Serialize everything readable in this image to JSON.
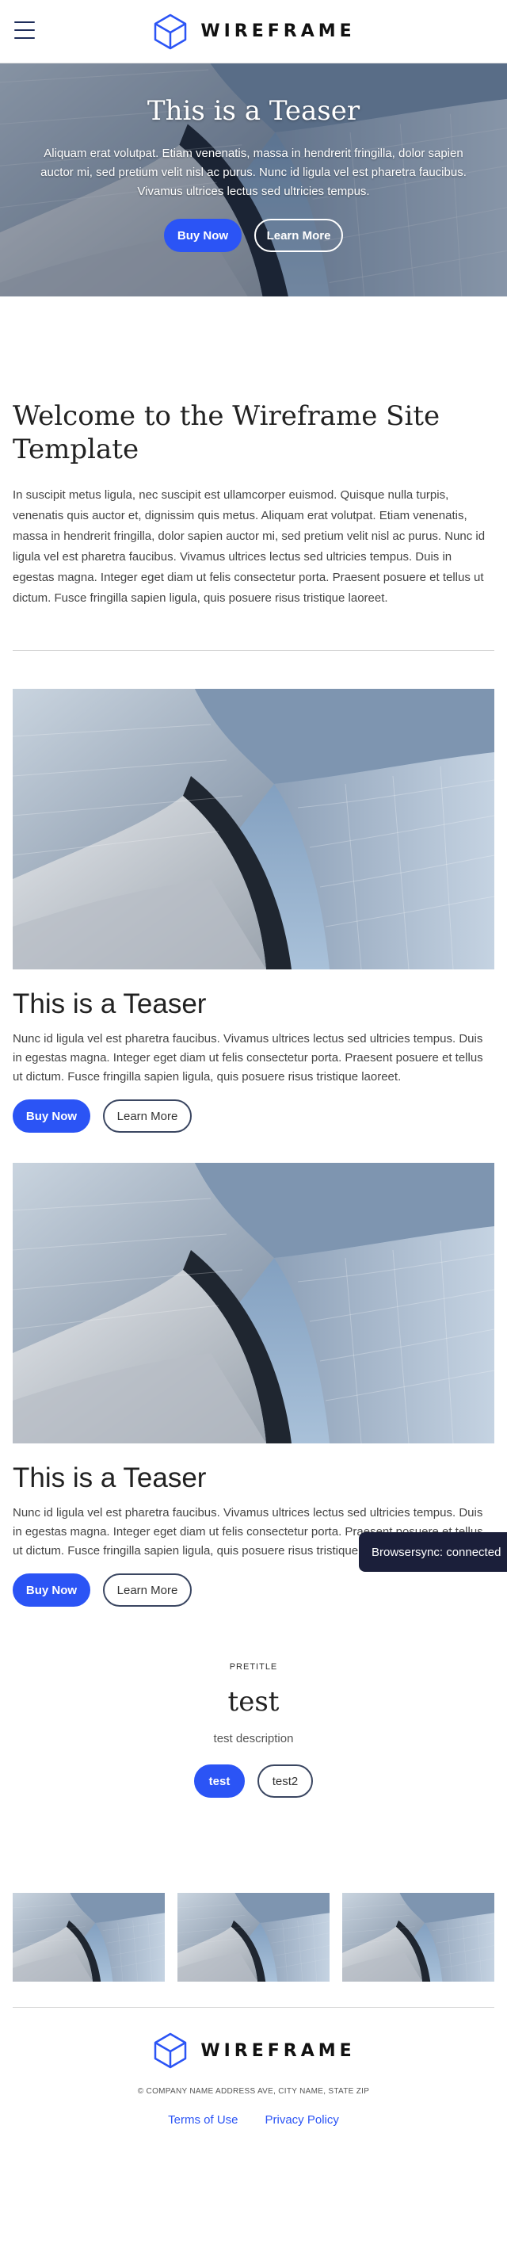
{
  "header": {
    "brand": "WIREFRAME",
    "menu_icon": "hamburger-menu-icon",
    "logo_icon": "cube-logo-icon"
  },
  "hero": {
    "title": "This is a Teaser",
    "text": "Aliquam erat volutpat. Etiam venenatis, massa in hendrerit fringilla, dolor sapien auctor mi, sed pretium velit nisl ac purus. Nunc id ligula vel est pharetra faucibus. Vivamus ultrices lectus sed ultricies tempus.",
    "primary_label": "Buy Now",
    "secondary_label": "Learn More"
  },
  "welcome": {
    "title": "Welcome to the Wireframe Site Template",
    "body": "In suscipit metus ligula, nec suscipit est ullamcorper euismod. Quisque nulla turpis, venenatis quis auctor et, dignissim quis metus. Aliquam erat volutpat. Etiam venenatis, massa in hendrerit fringilla, dolor sapien auctor mi, sed pretium velit nisl ac purus. Nunc id ligula vel est pharetra faucibus. Vivamus ultrices lectus sed ultricies tempus. Duis in egestas magna. Integer eget diam ut felis consectetur porta. Praesent posuere et tellus ut dictum. Fusce fringilla sapien ligula, quis posuere risus tristique laoreet."
  },
  "teasers": [
    {
      "title": "This is a Teaser",
      "text": "Nunc id ligula vel est pharetra faucibus. Vivamus ultrices lectus sed ultricies tempus. Duis in egestas magna. Integer eget diam ut felis consectetur porta. Praesent posuere et tellus ut dictum. Fusce fringilla sapien ligula, quis posuere risus tristique laoreet.",
      "primary_label": "Buy Now",
      "secondary_label": "Learn More"
    },
    {
      "title": "This is a Teaser",
      "text": "Nunc id ligula vel est pharetra faucibus. Vivamus ultrices lectus sed ultricies tempus. Duis in egestas magna. Integer eget diam ut felis consectetur porta. Praesent posuere et tellus ut dictum. Fusce fringilla sapien ligula, quis posuere risus tristique laoreet.",
      "primary_label": "Buy Now",
      "secondary_label": "Learn More"
    }
  ],
  "promo": {
    "pretitle": "PRETITLE",
    "title": "test",
    "description": "test description",
    "primary_label": "test",
    "secondary_label": "test2"
  },
  "footer": {
    "brand": "WIREFRAME",
    "copyright": "© COMPANY NAME ADDRESS AVE, CITY NAME, STATE ZIP",
    "links": [
      "Terms of Use",
      "Privacy Policy"
    ]
  },
  "toast": {
    "text": "Browsersync: connected"
  },
  "colors": {
    "accent": "#2b54f5",
    "toast_bg": "#1b1f3a"
  }
}
